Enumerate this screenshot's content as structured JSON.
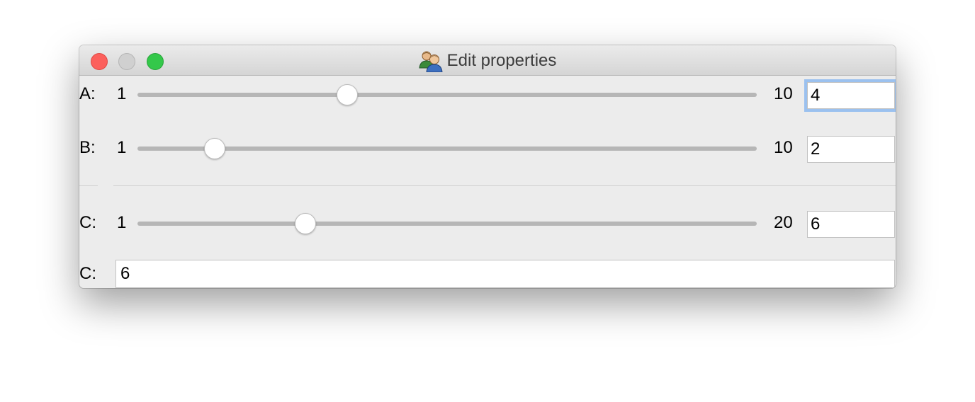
{
  "window": {
    "title": "Edit properties",
    "icon": "users-icon"
  },
  "rows": [
    {
      "label": "A:",
      "min": "1",
      "max": "10",
      "value": "4",
      "slider_value": 4,
      "slider_min": 1,
      "slider_max": 10,
      "focused": true
    },
    {
      "label": "B:",
      "min": "1",
      "max": "10",
      "value": "2",
      "slider_value": 2,
      "slider_min": 1,
      "slider_max": 10,
      "focused": false
    },
    {
      "label": "C:",
      "min": "1",
      "max": "20",
      "value": "6",
      "slider_value": 6,
      "slider_min": 1,
      "slider_max": 20,
      "focused": false
    }
  ],
  "text_row": {
    "label": "C:",
    "value": "6"
  },
  "colors": {
    "close": "#fc605c",
    "minimize": "#d0d0d0",
    "zoom": "#34c84a",
    "focus_ring": "#9bc1ef"
  }
}
